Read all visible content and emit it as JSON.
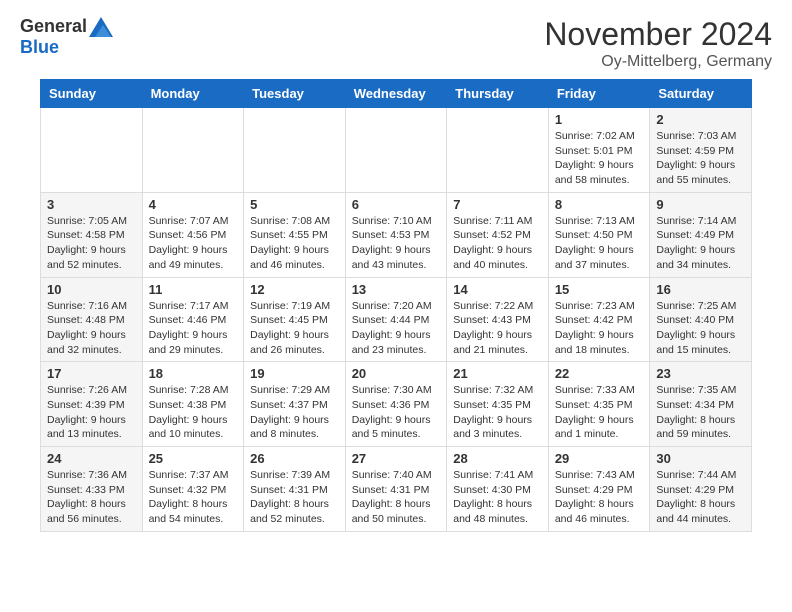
{
  "logo": {
    "general": "General",
    "blue": "Blue"
  },
  "header": {
    "month": "November 2024",
    "location": "Oy-Mittelberg, Germany"
  },
  "weekdays": [
    "Sunday",
    "Monday",
    "Tuesday",
    "Wednesday",
    "Thursday",
    "Friday",
    "Saturday"
  ],
  "weeks": [
    [
      {
        "day": "",
        "info": "",
        "empty": true
      },
      {
        "day": "",
        "info": "",
        "empty": true
      },
      {
        "day": "",
        "info": "",
        "empty": true
      },
      {
        "day": "",
        "info": "",
        "empty": true
      },
      {
        "day": "",
        "info": "",
        "empty": true
      },
      {
        "day": "1",
        "info": "Sunrise: 7:02 AM\nSunset: 5:01 PM\nDaylight: 9 hours and 58 minutes.",
        "empty": false
      },
      {
        "day": "2",
        "info": "Sunrise: 7:03 AM\nSunset: 4:59 PM\nDaylight: 9 hours and 55 minutes.",
        "empty": false
      }
    ],
    [
      {
        "day": "3",
        "info": "Sunrise: 7:05 AM\nSunset: 4:58 PM\nDaylight: 9 hours and 52 minutes.",
        "empty": false
      },
      {
        "day": "4",
        "info": "Sunrise: 7:07 AM\nSunset: 4:56 PM\nDaylight: 9 hours and 49 minutes.",
        "empty": false
      },
      {
        "day": "5",
        "info": "Sunrise: 7:08 AM\nSunset: 4:55 PM\nDaylight: 9 hours and 46 minutes.",
        "empty": false
      },
      {
        "day": "6",
        "info": "Sunrise: 7:10 AM\nSunset: 4:53 PM\nDaylight: 9 hours and 43 minutes.",
        "empty": false
      },
      {
        "day": "7",
        "info": "Sunrise: 7:11 AM\nSunset: 4:52 PM\nDaylight: 9 hours and 40 minutes.",
        "empty": false
      },
      {
        "day": "8",
        "info": "Sunrise: 7:13 AM\nSunset: 4:50 PM\nDaylight: 9 hours and 37 minutes.",
        "empty": false
      },
      {
        "day": "9",
        "info": "Sunrise: 7:14 AM\nSunset: 4:49 PM\nDaylight: 9 hours and 34 minutes.",
        "empty": false
      }
    ],
    [
      {
        "day": "10",
        "info": "Sunrise: 7:16 AM\nSunset: 4:48 PM\nDaylight: 9 hours and 32 minutes.",
        "empty": false
      },
      {
        "day": "11",
        "info": "Sunrise: 7:17 AM\nSunset: 4:46 PM\nDaylight: 9 hours and 29 minutes.",
        "empty": false
      },
      {
        "day": "12",
        "info": "Sunrise: 7:19 AM\nSunset: 4:45 PM\nDaylight: 9 hours and 26 minutes.",
        "empty": false
      },
      {
        "day": "13",
        "info": "Sunrise: 7:20 AM\nSunset: 4:44 PM\nDaylight: 9 hours and 23 minutes.",
        "empty": false
      },
      {
        "day": "14",
        "info": "Sunrise: 7:22 AM\nSunset: 4:43 PM\nDaylight: 9 hours and 21 minutes.",
        "empty": false
      },
      {
        "day": "15",
        "info": "Sunrise: 7:23 AM\nSunset: 4:42 PM\nDaylight: 9 hours and 18 minutes.",
        "empty": false
      },
      {
        "day": "16",
        "info": "Sunrise: 7:25 AM\nSunset: 4:40 PM\nDaylight: 9 hours and 15 minutes.",
        "empty": false
      }
    ],
    [
      {
        "day": "17",
        "info": "Sunrise: 7:26 AM\nSunset: 4:39 PM\nDaylight: 9 hours and 13 minutes.",
        "empty": false
      },
      {
        "day": "18",
        "info": "Sunrise: 7:28 AM\nSunset: 4:38 PM\nDaylight: 9 hours and 10 minutes.",
        "empty": false
      },
      {
        "day": "19",
        "info": "Sunrise: 7:29 AM\nSunset: 4:37 PM\nDaylight: 9 hours and 8 minutes.",
        "empty": false
      },
      {
        "day": "20",
        "info": "Sunrise: 7:30 AM\nSunset: 4:36 PM\nDaylight: 9 hours and 5 minutes.",
        "empty": false
      },
      {
        "day": "21",
        "info": "Sunrise: 7:32 AM\nSunset: 4:35 PM\nDaylight: 9 hours and 3 minutes.",
        "empty": false
      },
      {
        "day": "22",
        "info": "Sunrise: 7:33 AM\nSunset: 4:35 PM\nDaylight: 9 hours and 1 minute.",
        "empty": false
      },
      {
        "day": "23",
        "info": "Sunrise: 7:35 AM\nSunset: 4:34 PM\nDaylight: 8 hours and 59 minutes.",
        "empty": false
      }
    ],
    [
      {
        "day": "24",
        "info": "Sunrise: 7:36 AM\nSunset: 4:33 PM\nDaylight: 8 hours and 56 minutes.",
        "empty": false
      },
      {
        "day": "25",
        "info": "Sunrise: 7:37 AM\nSunset: 4:32 PM\nDaylight: 8 hours and 54 minutes.",
        "empty": false
      },
      {
        "day": "26",
        "info": "Sunrise: 7:39 AM\nSunset: 4:31 PM\nDaylight: 8 hours and 52 minutes.",
        "empty": false
      },
      {
        "day": "27",
        "info": "Sunrise: 7:40 AM\nSunset: 4:31 PM\nDaylight: 8 hours and 50 minutes.",
        "empty": false
      },
      {
        "day": "28",
        "info": "Sunrise: 7:41 AM\nSunset: 4:30 PM\nDaylight: 8 hours and 48 minutes.",
        "empty": false
      },
      {
        "day": "29",
        "info": "Sunrise: 7:43 AM\nSunset: 4:29 PM\nDaylight: 8 hours and 46 minutes.",
        "empty": false
      },
      {
        "day": "30",
        "info": "Sunrise: 7:44 AM\nSunset: 4:29 PM\nDaylight: 8 hours and 44 minutes.",
        "empty": false
      }
    ]
  ]
}
